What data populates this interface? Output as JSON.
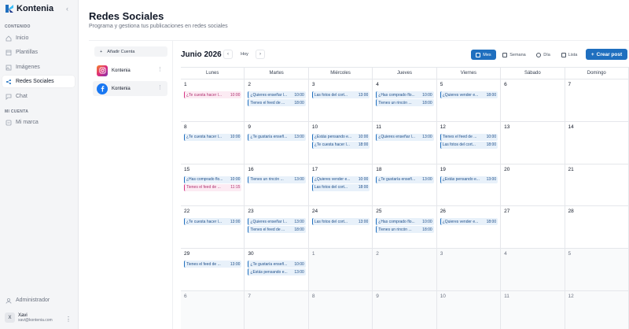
{
  "app": {
    "name": "Kontenia"
  },
  "sidebar": {
    "section_content": "CONTENIDO",
    "items": [
      {
        "label": "Inicio",
        "active": false
      },
      {
        "label": "Plantillas",
        "active": false
      },
      {
        "label": "Imágenes",
        "active": false
      },
      {
        "label": "Redes Sociales",
        "active": true
      },
      {
        "label": "Chat",
        "active": false
      }
    ],
    "section_account": "MI CUENTA",
    "account_items": [
      {
        "label": "Mi marca"
      }
    ],
    "admin": "Administrador",
    "user": {
      "initial": "X",
      "name": "Xavi",
      "email": "xavi@kontenia.com"
    }
  },
  "header": {
    "title": "Redes Sociales",
    "subtitle": "Programa y gestiona tus publicaciones en redes sociales"
  },
  "accounts": {
    "add_label": "Añadir Cuenta",
    "list": [
      {
        "name": "Kontenia",
        "network": "instagram",
        "icon": "instagram-icon"
      },
      {
        "name": "Kontenia",
        "network": "facebook",
        "icon": "facebook-icon"
      }
    ]
  },
  "toolbar": {
    "month": "Junio 2026",
    "prev": "‹",
    "next": "›",
    "today": "Hoy",
    "views": [
      "Mes",
      "Semana",
      "Día",
      "Lista"
    ],
    "active_view": "Mes",
    "create": "Crear post"
  },
  "calendar": {
    "weekdays": [
      "Lunes",
      "Martes",
      "Miércoles",
      "Jueves",
      "Viernes",
      "Sábado",
      "Domingo"
    ],
    "weeks": [
      [
        {
          "day": "1",
          "posts": [
            {
              "text": "¿Te cuesta hacer l...",
              "time": "10:00",
              "net": "ig"
            }
          ]
        },
        {
          "day": "2",
          "posts": [
            {
              "text": "¿Quieres enseñar l...",
              "time": "10:00",
              "net": "fb"
            },
            {
              "text": "Tienes el feed de ...",
              "time": "18:00",
              "net": "fb"
            }
          ]
        },
        {
          "day": "3",
          "posts": [
            {
              "text": "Las fotos del cort...",
              "time": "13:00",
              "net": "fb"
            }
          ]
        },
        {
          "day": "4",
          "posts": [
            {
              "text": "¿Has comprado flo...",
              "time": "10:00",
              "net": "fb"
            },
            {
              "text": "Tienes un rincón ...",
              "time": "18:00",
              "net": "fb"
            }
          ]
        },
        {
          "day": "5",
          "posts": [
            {
              "text": "¿Quieres vender e...",
              "time": "18:00",
              "net": "fb"
            }
          ]
        },
        {
          "day": "6",
          "posts": []
        },
        {
          "day": "7",
          "posts": []
        }
      ],
      [
        {
          "day": "8",
          "posts": [
            {
              "text": "¿Te cuesta hacer l...",
              "time": "10:00",
              "net": "fb"
            }
          ]
        },
        {
          "day": "9",
          "posts": [
            {
              "text": "¿Te gustaría enseñ...",
              "time": "13:00",
              "net": "fb"
            }
          ]
        },
        {
          "day": "10",
          "posts": [
            {
              "text": "¿Estás pensando e...",
              "time": "10:00",
              "net": "fb"
            },
            {
              "text": "¿Te cuesta hacer l...",
              "time": "18:00",
              "net": "fb"
            }
          ]
        },
        {
          "day": "11",
          "posts": [
            {
              "text": "¿Quieres enseñar l...",
              "time": "13:00",
              "net": "fb"
            }
          ]
        },
        {
          "day": "12",
          "posts": [
            {
              "text": "Tienes el feed de ...",
              "time": "10:00",
              "net": "fb"
            },
            {
              "text": "Las fotos del cort...",
              "time": "18:00",
              "net": "fb"
            }
          ]
        },
        {
          "day": "13",
          "posts": []
        },
        {
          "day": "14",
          "posts": []
        }
      ],
      [
        {
          "day": "15",
          "posts": [
            {
              "text": "¿Has comprado flo...",
              "time": "10:00",
              "net": "fb"
            },
            {
              "text": "Tienes el feed de ...",
              "time": "11:15",
              "net": "ig"
            }
          ]
        },
        {
          "day": "16",
          "posts": [
            {
              "text": "Tienes un rincón ...",
              "time": "13:00",
              "net": "fb"
            }
          ]
        },
        {
          "day": "17",
          "posts": [
            {
              "text": "¿Quieres vender e...",
              "time": "10:00",
              "net": "fb"
            },
            {
              "text": "Las fotos del cort...",
              "time": "18:00",
              "net": "fb"
            }
          ]
        },
        {
          "day": "18",
          "posts": [
            {
              "text": "¿Te gustaría enseñ...",
              "time": "13:00",
              "net": "fb"
            }
          ]
        },
        {
          "day": "19",
          "posts": [
            {
              "text": "¿Estás pensando e...",
              "time": "13:00",
              "net": "fb"
            }
          ]
        },
        {
          "day": "20",
          "posts": []
        },
        {
          "day": "21",
          "posts": []
        }
      ],
      [
        {
          "day": "22",
          "posts": [
            {
              "text": "¿Te cuesta hacer l...",
              "time": "13:00",
              "net": "fb"
            }
          ]
        },
        {
          "day": "23",
          "posts": [
            {
              "text": "¿Quieres enseñar l...",
              "time": "13:00",
              "net": "fb"
            },
            {
              "text": "Tienes el feed de ...",
              "time": "18:00",
              "net": "fb"
            }
          ]
        },
        {
          "day": "24",
          "posts": [
            {
              "text": "Las fotos del cort...",
              "time": "13:00",
              "net": "fb"
            }
          ]
        },
        {
          "day": "25",
          "posts": [
            {
              "text": "¿Has comprado flo...",
              "time": "10:00",
              "net": "fb"
            },
            {
              "text": "Tienes un rincón ...",
              "time": "18:00",
              "net": "fb"
            }
          ]
        },
        {
          "day": "26",
          "posts": [
            {
              "text": "¿Quieres vender e...",
              "time": "18:00",
              "net": "fb"
            }
          ]
        },
        {
          "day": "27",
          "posts": []
        },
        {
          "day": "28",
          "posts": []
        }
      ],
      [
        {
          "day": "29",
          "posts": [
            {
              "text": "Tienes el feed de ...",
              "time": "13:00",
              "net": "fb"
            }
          ]
        },
        {
          "day": "30",
          "posts": [
            {
              "text": "¿Te gustaría enseñ...",
              "time": "10:00",
              "net": "fb"
            },
            {
              "text": "¿Estás pensando e...",
              "time": "13:00",
              "net": "fb"
            }
          ]
        },
        {
          "day": "1",
          "out": true,
          "posts": []
        },
        {
          "day": "2",
          "out": true,
          "posts": []
        },
        {
          "day": "3",
          "out": true,
          "posts": []
        },
        {
          "day": "4",
          "out": true,
          "posts": []
        },
        {
          "day": "5",
          "out": true,
          "posts": []
        }
      ],
      [
        {
          "day": "6",
          "out": true,
          "posts": []
        },
        {
          "day": "7",
          "out": true,
          "posts": []
        },
        {
          "day": "8",
          "out": true,
          "tone": "next",
          "posts": []
        },
        {
          "day": "9",
          "out": true,
          "tone": "next",
          "posts": []
        },
        {
          "day": "10",
          "out": true,
          "posts": []
        },
        {
          "day": "11",
          "out": true,
          "tone": "far",
          "posts": []
        },
        {
          "day": "12",
          "out": true,
          "posts": []
        }
      ]
    ]
  },
  "colors": {
    "accent": "#1f6fbf",
    "instagram_post": "#d63384",
    "facebook_post": "#1f6fbf"
  }
}
